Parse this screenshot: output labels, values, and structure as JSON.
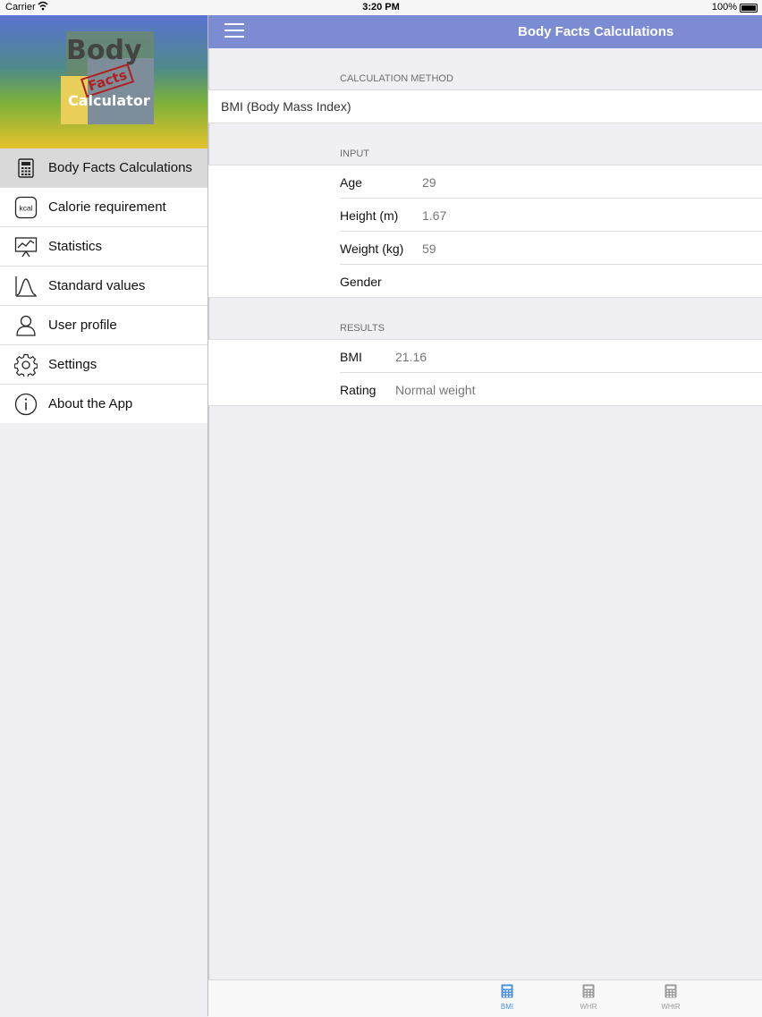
{
  "status_bar": {
    "carrier": "Carrier",
    "time": "3:20 PM",
    "battery": "100%"
  },
  "sidebar": {
    "logo": {
      "word1": "Body",
      "word2": "Facts",
      "word3": "Calculator"
    },
    "items": [
      {
        "label": "Body Facts Calculations",
        "icon": "calculator-icon",
        "active": true
      },
      {
        "label": "Calorie requirement",
        "icon": "kcal-icon"
      },
      {
        "label": "Statistics",
        "icon": "chart-board-icon"
      },
      {
        "label": "Standard values",
        "icon": "bell-curve-icon"
      },
      {
        "label": "User profile",
        "icon": "user-icon"
      },
      {
        "label": "Settings",
        "icon": "gear-icon"
      },
      {
        "label": "About the App",
        "icon": "info-icon"
      }
    ],
    "kcal_text": "kcal"
  },
  "navbar": {
    "title": "Body Facts Calculations"
  },
  "calculation": {
    "header": "CALCULATION METHOD",
    "value": "BMI (Body Mass Index)"
  },
  "input": {
    "header": "INPUT",
    "rows": [
      {
        "label": "Age",
        "value": "29"
      },
      {
        "label": "Height (m)",
        "value": "1.67"
      },
      {
        "label": "Weight (kg)",
        "value": "59"
      },
      {
        "label": "Gender",
        "value": ""
      }
    ]
  },
  "results": {
    "header": "RESULTS",
    "rows": [
      {
        "label": "BMI",
        "value": "21.16"
      },
      {
        "label": "Rating",
        "value": "Normal weight"
      }
    ]
  },
  "tabs": [
    {
      "label": "BMI",
      "active": true
    },
    {
      "label": "WHR",
      "active": false
    },
    {
      "label": "WHtR",
      "active": false
    }
  ],
  "colors": {
    "accent": "#7c8cd3",
    "tab_active": "#4a90e2",
    "tab_inactive": "#9b9b9b"
  }
}
